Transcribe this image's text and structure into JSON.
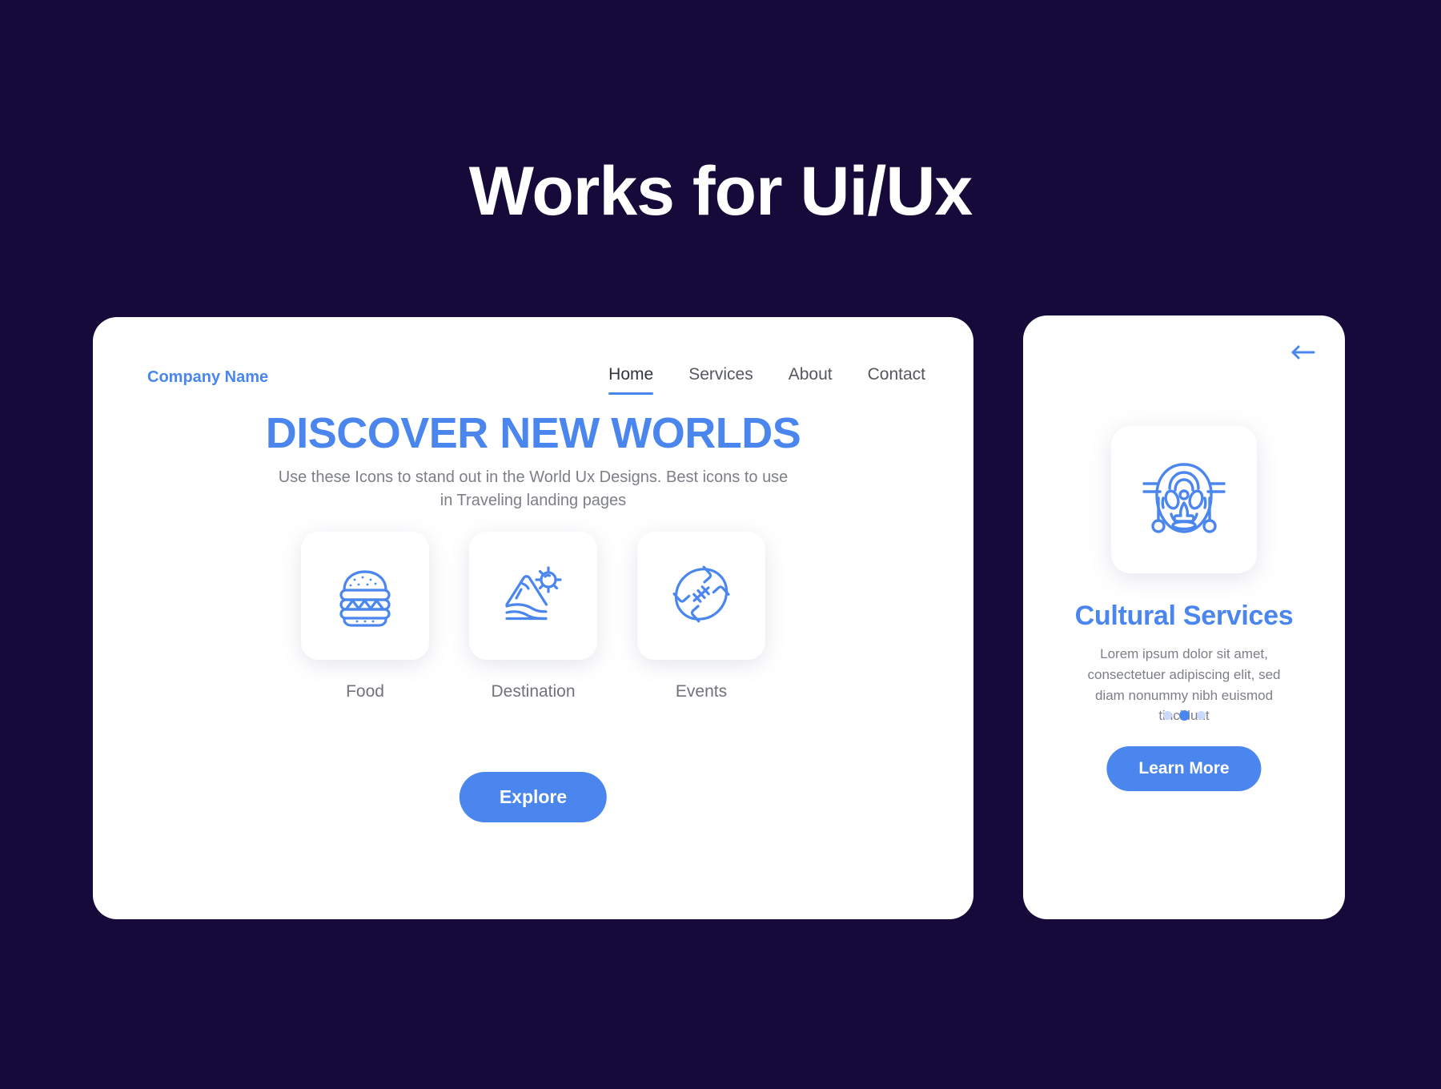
{
  "page": {
    "title": "Works for Ui/Ux",
    "background_color": "#150a3a",
    "accent_color": "#4a86ee"
  },
  "desktop": {
    "nav": {
      "brand": "Company Name",
      "links": [
        {
          "label": "Home",
          "active": true
        },
        {
          "label": "Services",
          "active": false
        },
        {
          "label": "About",
          "active": false
        },
        {
          "label": "Contact",
          "active": false
        }
      ]
    },
    "hero": {
      "heading": "DISCOVER NEW WORLDS",
      "subtitle": "Use these Icons to stand out in the World Ux Designs. Best icons to use in Traveling landing pages"
    },
    "tiles": [
      {
        "label": "Food",
        "icon": "burger-icon"
      },
      {
        "label": "Destination",
        "icon": "mountain-sun-icon"
      },
      {
        "label": "Events",
        "icon": "football-icon"
      }
    ],
    "cta": {
      "label": "Explore"
    }
  },
  "mobile": {
    "back_icon": "back-arrow-icon",
    "feature_icon": "tribal-mask-icon",
    "title": "Cultural Services",
    "description": "Lorem ipsum dolor sit amet, consectetuer adipiscing elit, sed diam nonummy nibh euismod tincidunt",
    "pagination": {
      "total": 3,
      "active_index": 1
    },
    "cta": {
      "label": "Learn More"
    }
  }
}
